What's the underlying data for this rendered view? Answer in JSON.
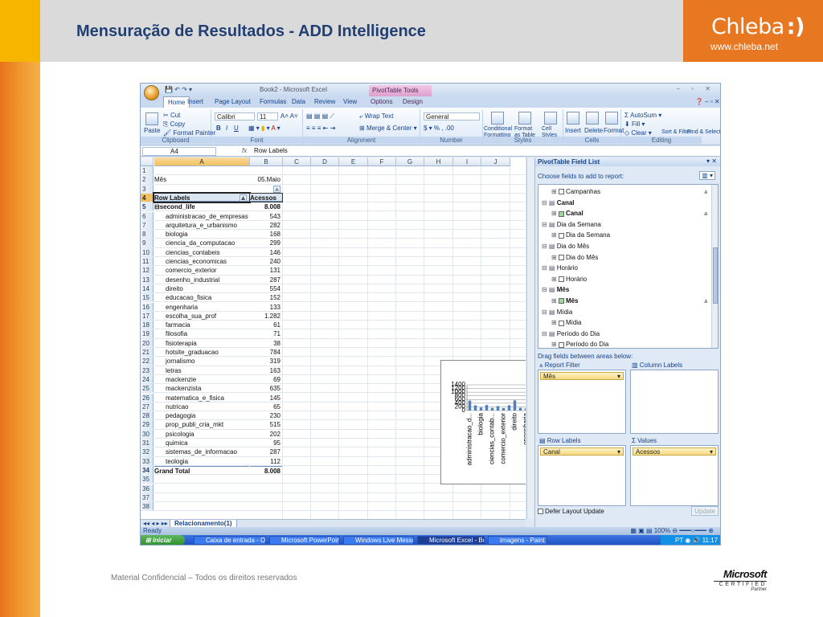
{
  "slide": {
    "title": "Mensuração de Resultados  -  ADD Intelligence",
    "logo_main": "Chleba",
    "logo_smile": ":)",
    "logo_url": "www.chleba.net",
    "footer": "Material Confidencial – Todos os direitos reservados",
    "ms_brand": "Microsoft",
    "ms_certified": "CERTIFIED",
    "ms_partner": "Partner",
    "colors": {
      "orange": "#e87722",
      "title_blue": "#213f73"
    }
  },
  "excel": {
    "window_title": "Book2 - Microsoft Excel",
    "context_tab": "PivotTable Tools",
    "tabs": [
      "Home",
      "Insert",
      "Page Layout",
      "Formulas",
      "Data",
      "Review",
      "View",
      "Options",
      "Design"
    ],
    "ribbon": {
      "clipboard": {
        "label": "Clipboard",
        "paste": "Paste",
        "cut": "Cut",
        "copy": "Copy",
        "format_painter": "Format Painter"
      },
      "font": {
        "label": "Font",
        "name": "Calibri",
        "size": "11",
        "bold": "B",
        "italic": "I",
        "underline": "U"
      },
      "alignment": {
        "label": "Alignment",
        "wrap": "Wrap Text",
        "merge": "Merge & Center"
      },
      "number": {
        "label": "Number",
        "format": "General",
        "percent": "%"
      },
      "styles": {
        "label": "Styles",
        "conditional": "Conditional Formatting",
        "format_table": "Format as Table",
        "cell_styles": "Cell Styles"
      },
      "cells": {
        "label": "Cells",
        "insert": "Insert",
        "delete": "Delete",
        "format": "Format"
      },
      "editing": {
        "label": "Editing",
        "autosum": "AutoSum",
        "fill": "Fill",
        "clear": "Clear",
        "sort": "Sort & Filter",
        "find": "Find & Select"
      }
    },
    "name_box": "A4",
    "fx": "fx",
    "formula": "Row Labels",
    "columns": [
      "A",
      "B",
      "C",
      "D",
      "E",
      "F",
      "G",
      "H",
      "I",
      "J"
    ],
    "filter": {
      "label": "Mês",
      "value": "05.Maio"
    },
    "pivot_header": {
      "row_labels": "Row Labels",
      "value": "Acessos"
    },
    "group": {
      "name": "second_life",
      "total": "8.008"
    },
    "rows": [
      {
        "label": "administracao_de_empresas",
        "value": "543"
      },
      {
        "label": "arquitetura_e_urbanismo",
        "value": "282"
      },
      {
        "label": "biologia",
        "value": "168"
      },
      {
        "label": "ciencia_da_computacao",
        "value": "299"
      },
      {
        "label": "ciencias_contabeis",
        "value": "146"
      },
      {
        "label": "ciencias_economicas",
        "value": "240"
      },
      {
        "label": "comercio_exterior",
        "value": "131"
      },
      {
        "label": "desenho_industrial",
        "value": "287"
      },
      {
        "label": "direito",
        "value": "554"
      },
      {
        "label": "educacao_fisica",
        "value": "152"
      },
      {
        "label": "engenharia",
        "value": "133"
      },
      {
        "label": "escolha_sua_prof",
        "value": "1.282"
      },
      {
        "label": "farmacia",
        "value": "61"
      },
      {
        "label": "filosofia",
        "value": "71"
      },
      {
        "label": "fisioterapia",
        "value": "38"
      },
      {
        "label": "hotsite_graduacao",
        "value": "784"
      },
      {
        "label": "jornalismo",
        "value": "319"
      },
      {
        "label": "letras",
        "value": "163"
      },
      {
        "label": "mackenzie",
        "value": "69"
      },
      {
        "label": "mackenzista",
        "value": "635"
      },
      {
        "label": "matematica_e_fisica",
        "value": "145"
      },
      {
        "label": "nutricao",
        "value": "65"
      },
      {
        "label": "pedagogia",
        "value": "230"
      },
      {
        "label": "prop_publi_cria_mkt",
        "value": "515"
      },
      {
        "label": "psicologia",
        "value": "202"
      },
      {
        "label": "quimica",
        "value": "95"
      },
      {
        "label": "sistemas_de_informacao",
        "value": "287"
      },
      {
        "label": "teologia",
        "value": "112"
      }
    ],
    "grand_total": {
      "label": "Grand Total",
      "value": "8.008"
    },
    "sheet_tab": "Relacionamento(1)",
    "status": "Ready",
    "zoom": "100%"
  },
  "chart_data": {
    "type": "bar",
    "title": "Total",
    "xlabel": "second_life",
    "legend": "Total",
    "legend_position": "right",
    "ylim": [
      0,
      1400
    ],
    "yticks": [
      0,
      200,
      400,
      600,
      800,
      1000,
      1200,
      1400
    ],
    "categories": [
      "administracao_d...",
      "",
      "biologia",
      "",
      "ciencias_contab...",
      "",
      "comercio_exterior",
      "",
      "direito",
      "",
      "engenharia",
      "",
      "farmacia",
      "",
      "fisioterapia",
      "",
      "jornalismo",
      "",
      "mackenzie",
      "",
      "matematica_e_fi...",
      "",
      "pedagogia",
      "",
      "psicologia",
      "",
      "sistemas_de_inf...",
      ""
    ],
    "series": [
      {
        "name": "Total",
        "values": [
          543,
          282,
          168,
          299,
          146,
          240,
          131,
          287,
          554,
          152,
          133,
          1282,
          61,
          71,
          38,
          784,
          319,
          163,
          69,
          635,
          145,
          65,
          230,
          515,
          202,
          95,
          287,
          112
        ]
      }
    ],
    "bar_color": "#4f81bd"
  },
  "pivot_pane": {
    "title": "PivotTable Field List",
    "choose": "Choose fields to add to report:",
    "fields": [
      {
        "name": "Campanhas",
        "sub": true,
        "checked": false,
        "bold": false,
        "filter": true
      },
      {
        "name": "Canal",
        "sub": false,
        "checked": false,
        "bold": true,
        "filter": false
      },
      {
        "name": "Canal",
        "sub": true,
        "checked": true,
        "bold": true,
        "filter": true
      },
      {
        "name": "Dia da Semana",
        "sub": false,
        "checked": false,
        "bold": false,
        "filter": false
      },
      {
        "name": "Dia da Semana",
        "sub": true,
        "checked": false,
        "bold": false,
        "filter": false
      },
      {
        "name": "Dia do Mês",
        "sub": false,
        "checked": false,
        "bold": false,
        "filter": false
      },
      {
        "name": "Dia do Mês",
        "sub": true,
        "checked": false,
        "bold": false,
        "filter": false
      },
      {
        "name": "Horário",
        "sub": false,
        "checked": false,
        "bold": false,
        "filter": false
      },
      {
        "name": "Horário",
        "sub": true,
        "checked": false,
        "bold": false,
        "filter": false
      },
      {
        "name": "Mês",
        "sub": false,
        "checked": false,
        "bold": true,
        "filter": false
      },
      {
        "name": "Mês",
        "sub": true,
        "checked": true,
        "bold": true,
        "filter": true
      },
      {
        "name": "Mídia",
        "sub": false,
        "checked": false,
        "bold": false,
        "filter": false
      },
      {
        "name": "Mídia",
        "sub": true,
        "checked": false,
        "bold": false,
        "filter": false
      },
      {
        "name": "Período do Dia",
        "sub": false,
        "checked": false,
        "bold": false,
        "filter": false
      },
      {
        "name": "Período do Dia",
        "sub": true,
        "checked": false,
        "bold": false,
        "filter": false
      }
    ],
    "drag": "Drag fields between areas below:",
    "report_filter": "Report Filter",
    "column_labels": "Column Labels",
    "row_labels": "Row Labels",
    "values": "Values",
    "filter_item": "Mês",
    "row_item": "Canal",
    "value_item": "Acessos",
    "defer": "Defer Layout Update",
    "update": "Update"
  },
  "taskbar": {
    "start": "Iniciar",
    "items": [
      "Caixa de entrada - O...",
      "Microsoft PowerPoint ...",
      "Windows Live Messen...",
      "Microsoft Excel - Book2",
      "imagens - Paint"
    ],
    "tray_lang": "PT",
    "time": "11:17"
  }
}
